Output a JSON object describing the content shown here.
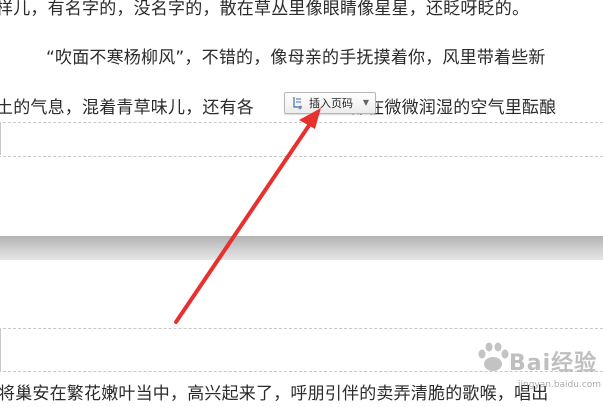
{
  "document": {
    "line1": "样儿，有名字的，没名字的，散在草丛里像眼睛像星星，还眨呀眨的。",
    "line2": "“吹面不寒杨柳风”，不错的，像母亲的手抚摸着你，风里带着些新",
    "line3_before": "土的气息，混着青草味儿，还有各",
    "line3_after": "都在微微润湿的空气里酝酿",
    "line_bottom": "将巢安在繁花嫩叶当中，高兴起来了，呼朋引伴的卖弄清脆的歌喉，唱出"
  },
  "insert_page_number_button": {
    "label": "插入页码",
    "icon": "page-number-icon"
  },
  "watermark": {
    "brand": "Bai经验",
    "url": "jingyan.baidu.com"
  },
  "colors": {
    "arrow": "#e8312f",
    "separator": "#c4c4c4",
    "dashed": "#c8c8c8"
  }
}
